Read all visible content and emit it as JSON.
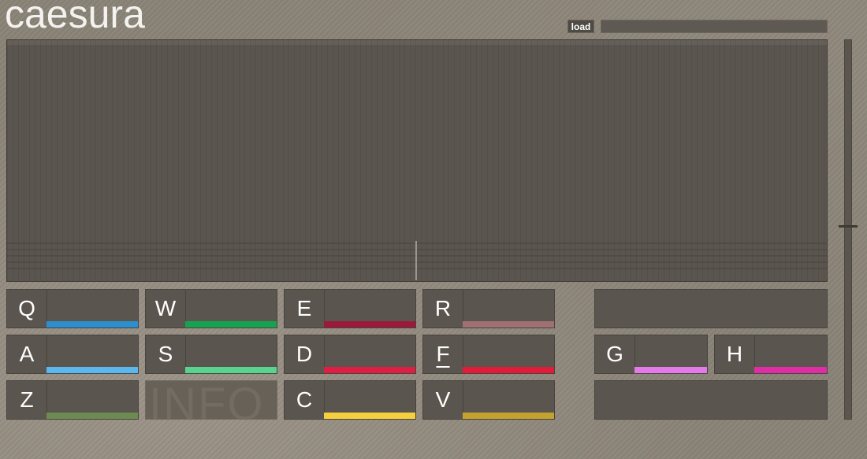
{
  "app": {
    "title": "caesura"
  },
  "toolbar": {
    "load_label": "load",
    "file_value": ""
  },
  "pads": [
    {
      "key": "Q",
      "color": "#2b8fce"
    },
    {
      "key": "W",
      "color": "#16a34f"
    },
    {
      "key": "E",
      "color": "#9b1a3b"
    },
    {
      "key": "R",
      "color": "#a07074"
    },
    {
      "key": "A",
      "color": "#5ab8ee"
    },
    {
      "key": "S",
      "color": "#58d48e"
    },
    {
      "key": "D",
      "color": "#e01e43"
    },
    {
      "key": "F",
      "color": "#e21b3a"
    },
    {
      "key": "Z",
      "color": "#6d8a50"
    },
    {
      "key": "C",
      "color": "#f5d03c"
    },
    {
      "key": "V",
      "color": "#c3a32e"
    },
    {
      "key": "G",
      "color": "#e47ae8"
    },
    {
      "key": "H",
      "color": "#e02da6"
    }
  ],
  "info": {
    "label": "INFO"
  },
  "slider": {
    "level": 0.51
  }
}
